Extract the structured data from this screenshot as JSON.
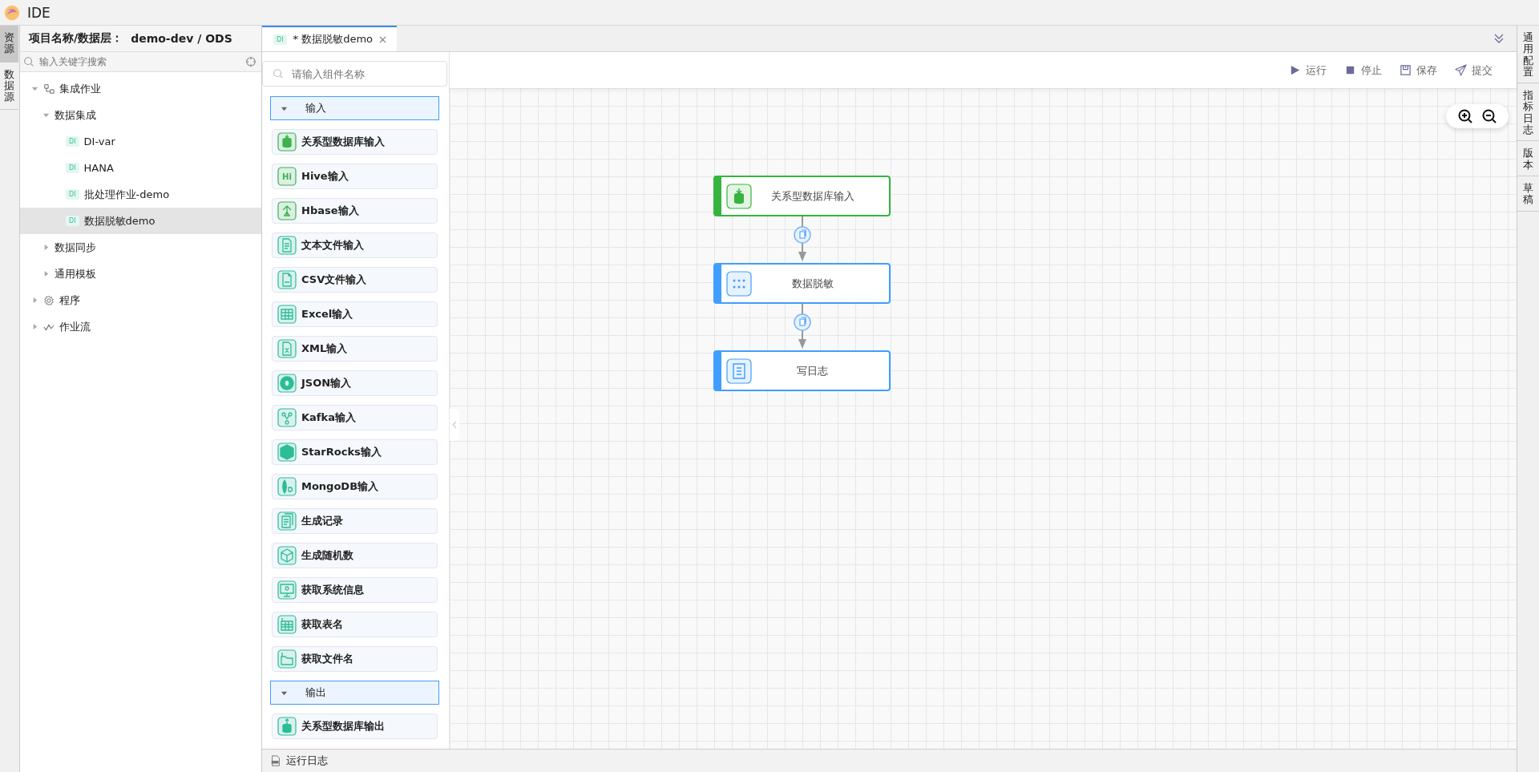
{
  "app": {
    "title": "IDE"
  },
  "left_tabs": [
    {
      "label": "资源",
      "selected": true
    },
    {
      "label": "数据源",
      "selected": false
    }
  ],
  "project": {
    "label": "项目名称/数据层：",
    "value": "demo-dev / ODS"
  },
  "tree_search": {
    "placeholder": "输入关键字搜索"
  },
  "tree": [
    {
      "label": "集成作业",
      "kind": "flow",
      "expanded": true,
      "selected": false,
      "children": [
        {
          "label": "数据集成",
          "expanded": true,
          "selected": false,
          "children": [
            {
              "label": "DI-var",
              "badge": "DI",
              "selected": false
            },
            {
              "label": "HANA",
              "badge": "DI",
              "selected": false
            },
            {
              "label": "批处理作业-demo",
              "badge": "DI",
              "selected": false
            },
            {
              "label": "数据脱敏demo",
              "badge": "DI",
              "selected": true
            }
          ]
        },
        {
          "label": "数据同步",
          "expanded": false,
          "selected": false
        },
        {
          "label": "通用模板",
          "expanded": false,
          "selected": false
        }
      ]
    },
    {
      "label": "程序",
      "kind": "gear",
      "expanded": false,
      "selected": false
    },
    {
      "label": "作业流",
      "kind": "workflow",
      "expanded": false,
      "selected": false
    }
  ],
  "editor_tabs": [
    {
      "badge": "DI",
      "label": "* 数据脱敏demo",
      "selected": true
    }
  ],
  "palette": {
    "placeholder": "请输入组件名称",
    "groups": [
      {
        "label": "输入",
        "expanded": true,
        "items": [
          {
            "label": "关系型数据库输入",
            "kind": "db"
          },
          {
            "label": "Hive输入",
            "kind": "hive",
            "icon_text": "Hi"
          },
          {
            "label": "Hbase输入",
            "kind": "hbase"
          },
          {
            "label": "文本文件输入",
            "kind": "textfile"
          },
          {
            "label": "CSV文件输入",
            "kind": "csv"
          },
          {
            "label": "Excel输入",
            "kind": "excel"
          },
          {
            "label": "XML输入",
            "kind": "xml"
          },
          {
            "label": "JSON输入",
            "kind": "json"
          },
          {
            "label": "Kafka输入",
            "kind": "kafka"
          },
          {
            "label": "StarRocks输入",
            "kind": "starrocks"
          },
          {
            "label": "MongoDB输入",
            "kind": "mongodb"
          },
          {
            "label": "生成记录",
            "kind": "records"
          },
          {
            "label": "生成随机数",
            "kind": "dice"
          },
          {
            "label": "获取系统信息",
            "kind": "monitor"
          },
          {
            "label": "获取表名",
            "kind": "table"
          },
          {
            "label": "获取文件名",
            "kind": "folder"
          }
        ]
      },
      {
        "label": "输出",
        "expanded": true,
        "items": [
          {
            "label": "关系型数据库输出",
            "kind": "dbout"
          }
        ]
      }
    ]
  },
  "toolbar": [
    {
      "label": "运行",
      "kind": "play"
    },
    {
      "label": "停止",
      "kind": "stop"
    },
    {
      "label": "保存",
      "kind": "save"
    },
    {
      "label": "提交",
      "kind": "send"
    }
  ],
  "canvas": {
    "nodes": [
      {
        "label": "关系型数据库输入",
        "kind": "db",
        "color": "#36b43f"
      },
      {
        "label": "数据脱敏",
        "kind": "mask",
        "color": "#409eff"
      },
      {
        "label": "写日志",
        "kind": "log",
        "color": "#409eff"
      }
    ]
  },
  "right_tabs": [
    {
      "label": "通用配置"
    },
    {
      "label": "指标日志"
    },
    {
      "label": "版本"
    },
    {
      "label": "草稿"
    }
  ],
  "bottom_bar": {
    "label": "运行日志"
  }
}
